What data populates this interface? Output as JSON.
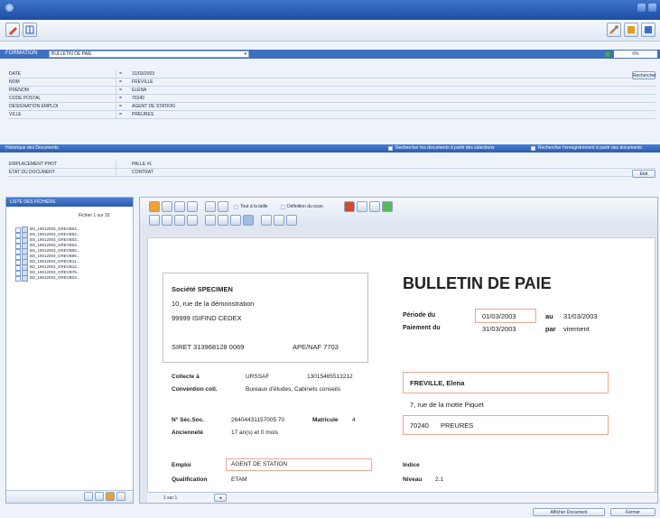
{
  "selector": {
    "label": "FORMATION",
    "value": "BULLETIN DE PAIE",
    "progress_text": "0%"
  },
  "properties": [
    {
      "key": "DATE",
      "op": "=",
      "value": "31/03/2003"
    },
    {
      "key": "NOM",
      "op": "=",
      "value": "FREVILLE"
    },
    {
      "key": "PRENOM",
      "op": "=",
      "value": "ELENA"
    },
    {
      "key": "CODE POSTAL",
      "op": "=",
      "value": "70240"
    },
    {
      "key": "DESIGNATION EMPLOI",
      "op": "=",
      "value": "AGENT DE STATION"
    },
    {
      "key": "VILLE",
      "op": "=",
      "value": "PREURES"
    }
  ],
  "props_button": "Rechercher",
  "band": {
    "title": "Historique des Documents",
    "opt1": "Rechercher les documents à partir des sélections",
    "opt2": "Rechercher l'enregistrement à partir des documents"
  },
  "doc_props": [
    {
      "key": "EMPLACEMENT PHOT",
      "value": "PALLE #1"
    },
    {
      "key": "ETAT DU DOCUMENT",
      "value": "CONTRAT"
    }
  ],
  "doc_props_button": "Etat",
  "left_panel": {
    "title": "LISTE DES FICHIERS",
    "count": "Fichier 1 sur 10",
    "files": [
      "BS_19012003_GREVB04...",
      "BS_19012003_GREVB54...",
      "BS_19012003_GREVB03...",
      "BS_19012003_GREVB03...",
      "BS_19012003_GREVB05...",
      "BS_19012003_GREVB06...",
      "BS_19012003_GREVB11...",
      "BS_19012003_GREVB12...",
      "BS_19012003_GREVB78...",
      "BS_19012003_GREVB23..."
    ]
  },
  "doc_toolbar": {
    "opt1": "Tout à la taille",
    "opt2": "Définition du scan"
  },
  "payslip": {
    "company": "Société SPECIMEN",
    "company_addr1": "10, rue de la démonstration",
    "company_addr2": "99999  ISIFIND CEDEX",
    "siret": "SIRET 313968128 0069",
    "apenaf": "APE/NAF 7703",
    "title": "BULLETIN DE PAIE",
    "periode_label": "Période du",
    "periode_from": "01/03/2003",
    "au": "au",
    "periode_to": "31/03/2003",
    "paiement_label": "Paiement du",
    "paiement_date": "31/03/2003",
    "par": "par",
    "paiement_mode": "virement",
    "collecte_label": "Collecte à",
    "collecte_org": "URSSAF",
    "collecte_num": "13015465513212",
    "convention_label": "Convention coll.",
    "convention_val": "Bureaux d'études, Cabinets conseils",
    "employee_name": "FREVILLE, Elena",
    "employee_addr": "7, rue de la motte Piquet",
    "employee_cp": "70240",
    "employee_city": "PREURES",
    "secsoc_label": "N° Séc.Soc.",
    "secsoc_val": "26404431157005  70",
    "matricule_label": "Matricule",
    "matricule_val": "4",
    "anciennete_label": "Ancienneté",
    "anciennete_val": "17 an(s) et 0 mois",
    "emploi_label": "Emploi",
    "emploi_val": "AGENT DE STATION",
    "qualif_label": "Qualification",
    "qualif_val": "ETAM",
    "indice_label": "Indice",
    "niveau_label": "Niveau",
    "niveau_val": "2.1"
  },
  "page_nav": "1 sur 1",
  "status": {
    "btn1": "Afficher Document",
    "btn2": "Fermer"
  },
  "colors": {
    "titlebar": "#1d4ea4",
    "accent_box": "#e8a88f"
  }
}
